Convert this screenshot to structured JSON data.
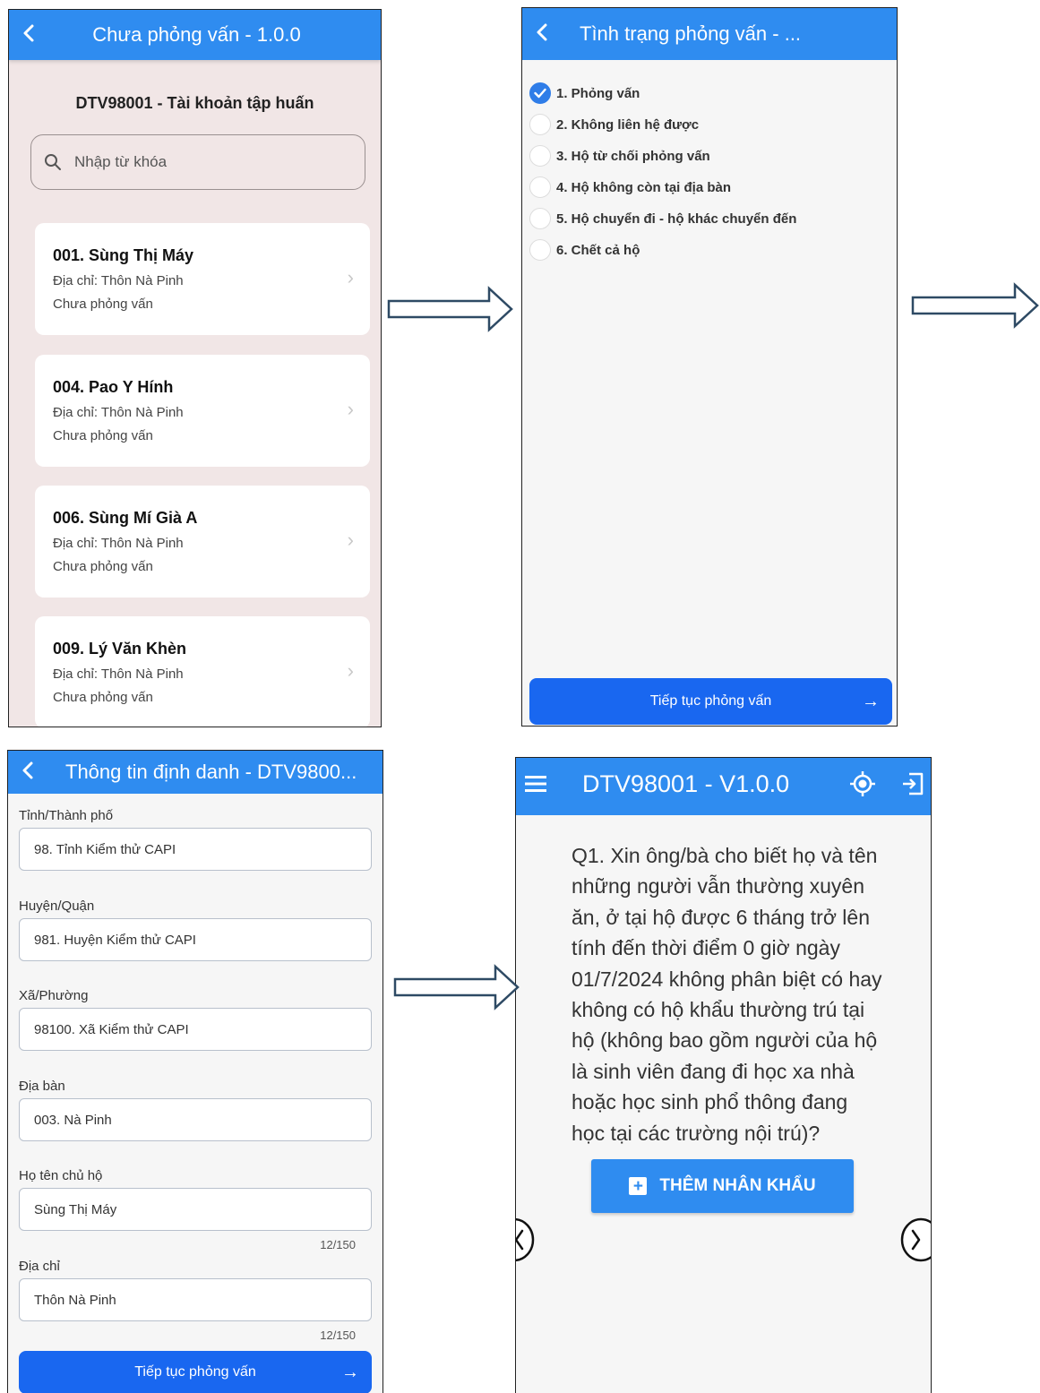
{
  "screen1": {
    "title": "Chưa phỏng vấn - 1.0.0",
    "account": "DTV98001 - Tài khoản tập huấn",
    "search_placeholder": "Nhập từ khóa",
    "households": [
      {
        "name": "001. Sùng Thị Máy",
        "address": "Địa chỉ: Thôn Nà Pinh",
        "status": "Chưa phỏng vấn"
      },
      {
        "name": "004. Pao Y Hính",
        "address": "Địa chỉ: Thôn Nà Pinh",
        "status": "Chưa phỏng vấn"
      },
      {
        "name": "006. Sùng Mí Già A",
        "address": "Địa chỉ: Thôn Nà Pinh",
        "status": "Chưa phỏng vấn"
      },
      {
        "name": "009. Lý Văn Khèn",
        "address": "Địa chỉ: Thôn Nà Pinh",
        "status": "Chưa phỏng vấn"
      }
    ]
  },
  "screen2": {
    "title": "Tình trạng phỏng vấn - ...",
    "options": [
      {
        "label": "1. Phỏng vấn",
        "checked": true
      },
      {
        "label": "2. Không liên hệ được",
        "checked": false
      },
      {
        "label": "3. Hộ từ chối phỏng vấn",
        "checked": false
      },
      {
        "label": "4. Hộ không còn tại địa bàn",
        "checked": false
      },
      {
        "label": "5. Hộ chuyển đi - hộ khác chuyển đến",
        "checked": false
      },
      {
        "label": "6. Chết cả hộ",
        "checked": false
      }
    ],
    "continue_label": "Tiếp tục phỏng vấn"
  },
  "screen3": {
    "title": "Thông tin định danh - DTV9800...",
    "fields": [
      {
        "label": "Tỉnh/Thành phố",
        "value": "98. Tỉnh Kiểm thử CAPI"
      },
      {
        "label": "Huyện/Quận",
        "value": "981. Huyện Kiểm thử CAPI"
      },
      {
        "label": "Xã/Phường",
        "value": "98100. Xã Kiểm thử CAPI"
      },
      {
        "label": "Địa bàn",
        "value": "003. Nà Pinh"
      },
      {
        "label": "Họ tên chủ hộ",
        "value": "Sùng Thị Máy",
        "counter": "12/150"
      },
      {
        "label": "Địa chỉ",
        "value": "Thôn Nà Pinh",
        "counter": "12/150"
      }
    ],
    "continue_label": "Tiếp tục phỏng vấn"
  },
  "screen4": {
    "title": "DTV98001 - V1.0.0",
    "question": "Q1. Xin ông/bà cho biết họ và tên những người vẫn thường xuyên ăn, ở tại hộ được 6 tháng trở lên tính đến thời điểm 0 giờ ngày 01/7/2024 không phân biệt có hay không có hộ khẩu thường trú tại hộ (không bao gồm người của hộ là sinh viên đang đi học xa nhà hoặc học sinh phổ thông đang học tại các trường nội trú)?",
    "add_button": "THÊM NHÂN KHẨU"
  },
  "icons": {
    "back": "chevron-left-icon",
    "search": "search-icon",
    "chevron": "chevron-right-icon",
    "check": "check-icon",
    "arrow": "arrow-right-icon",
    "menu": "menu-icon",
    "location": "gps-target-icon",
    "logout": "logout-icon",
    "plus": "plus-icon"
  },
  "colors": {
    "appbar": "#2f8cf0",
    "primary_button": "#1967f0",
    "list_background": "#f1e6e6"
  }
}
